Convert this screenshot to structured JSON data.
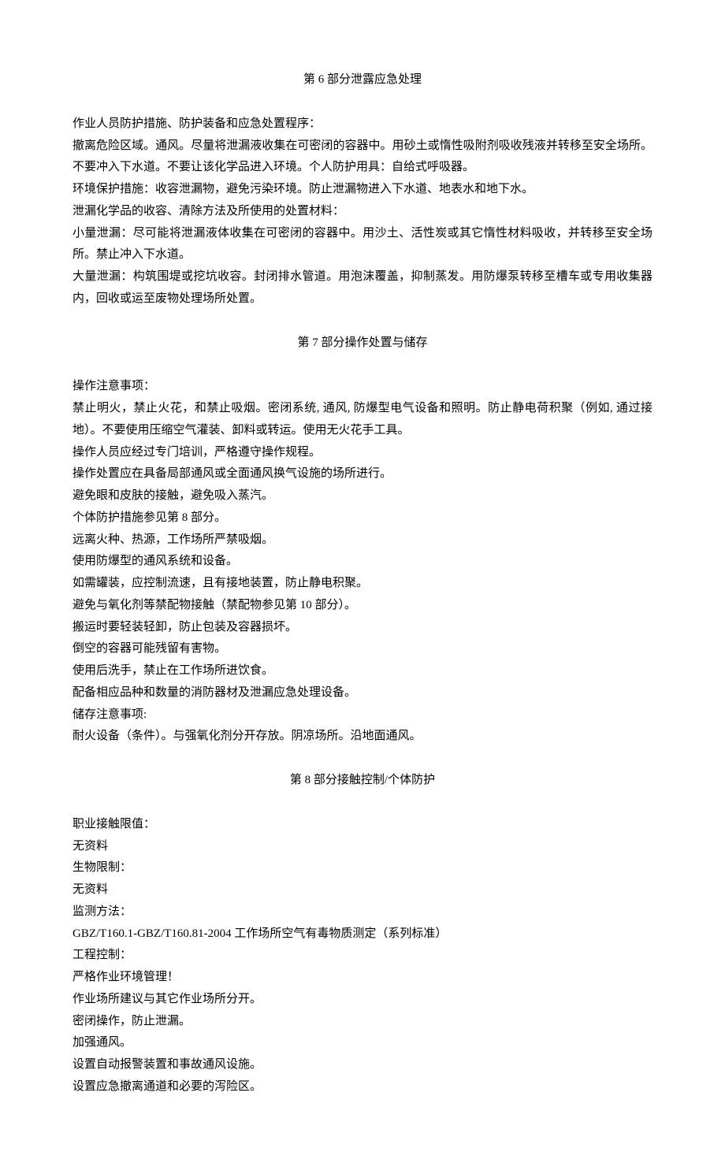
{
  "section6": {
    "title": "第 6 部分泄露应急处理",
    "lines": [
      "作业人员防护措施、防护装备和应急处置程序：",
      "撤离危险区域。通风。尽量将泄漏液收集在可密闭的容器中。用砂土或惰性吸附剂吸收残液并转移至安全场所。不要冲入下水道。不要让该化学品进入环境。个人防护用具：自给式呼吸器。",
      "环境保护措施：收容泄漏物，避免污染环境。防止泄漏物进入下水道、地表水和地下水。",
      "泄漏化学品的收容、清除方法及所使用的处置材料：",
      "小量泄漏：尽可能将泄漏液体收集在可密闭的容器中。用沙土、活性炭或其它惰性材料吸收，并转移至安全场所。禁止冲入下水道。",
      "大量泄漏：构筑围堤或挖坑收容。封闭排水管道。用泡沫覆盖，抑制蒸发。用防爆泵转移至槽车或专用收集器内，回收或运至废物处理场所处置。"
    ]
  },
  "section7": {
    "title": "第 7 部分操作处置与储存",
    "lines": [
      "操作注意事项：",
      "禁止明火，禁止火花，和禁止吸烟。密闭系统, 通风, 防爆型电气设备和照明。防止静电荷积聚（例如, 通过接地）。不要使用压缩空气灌装、卸料或转运。使用无火花手工具。",
      "操作人员应经过专门培训，严格遵守操作规程。",
      "操作处置应在具备局部通风或全面通风换气设施的场所进行。",
      "避免眼和皮肤的接触，避免吸入蒸汽。",
      "个体防护措施参见第 8 部分。",
      "远离火种、热源，工作场所严禁吸烟。",
      "使用防爆型的通风系统和设备。",
      "如需罐装，应控制流速，且有接地装置，防止静电积聚。",
      "避免与氧化剂等禁配物接触（禁配物参见第 10 部分）。",
      "搬运时要轻装轻卸，防止包装及容器损坏。",
      "倒空的容器可能残留有害物。",
      "使用后洗手，禁止在工作场所进饮食。",
      "配备相应品种和数量的消防器材及泄漏应急处理设备。",
      "储存注意事项:",
      "耐火设备（条件）。与强氧化剂分开存放。阴凉场所。沿地面通风。"
    ]
  },
  "section8": {
    "title": "第 8 部分接触控制/个体防护",
    "lines": [
      "职业接触限值：",
      "无资料",
      "生物限制：",
      "无资料",
      "监测方法：",
      "GBZ/T160.1-GBZ/T160.81-2004 工作场所空气有毒物质测定（系列标准）",
      "工程控制：",
      "严格作业环境管理！",
      "作业场所建议与其它作业场所分开。",
      "密闭操作，防止泄漏。",
      "加强通风。",
      "设置自动报警装置和事故通风设施。",
      "设置应急撤离通道和必要的泻险区。"
    ]
  }
}
